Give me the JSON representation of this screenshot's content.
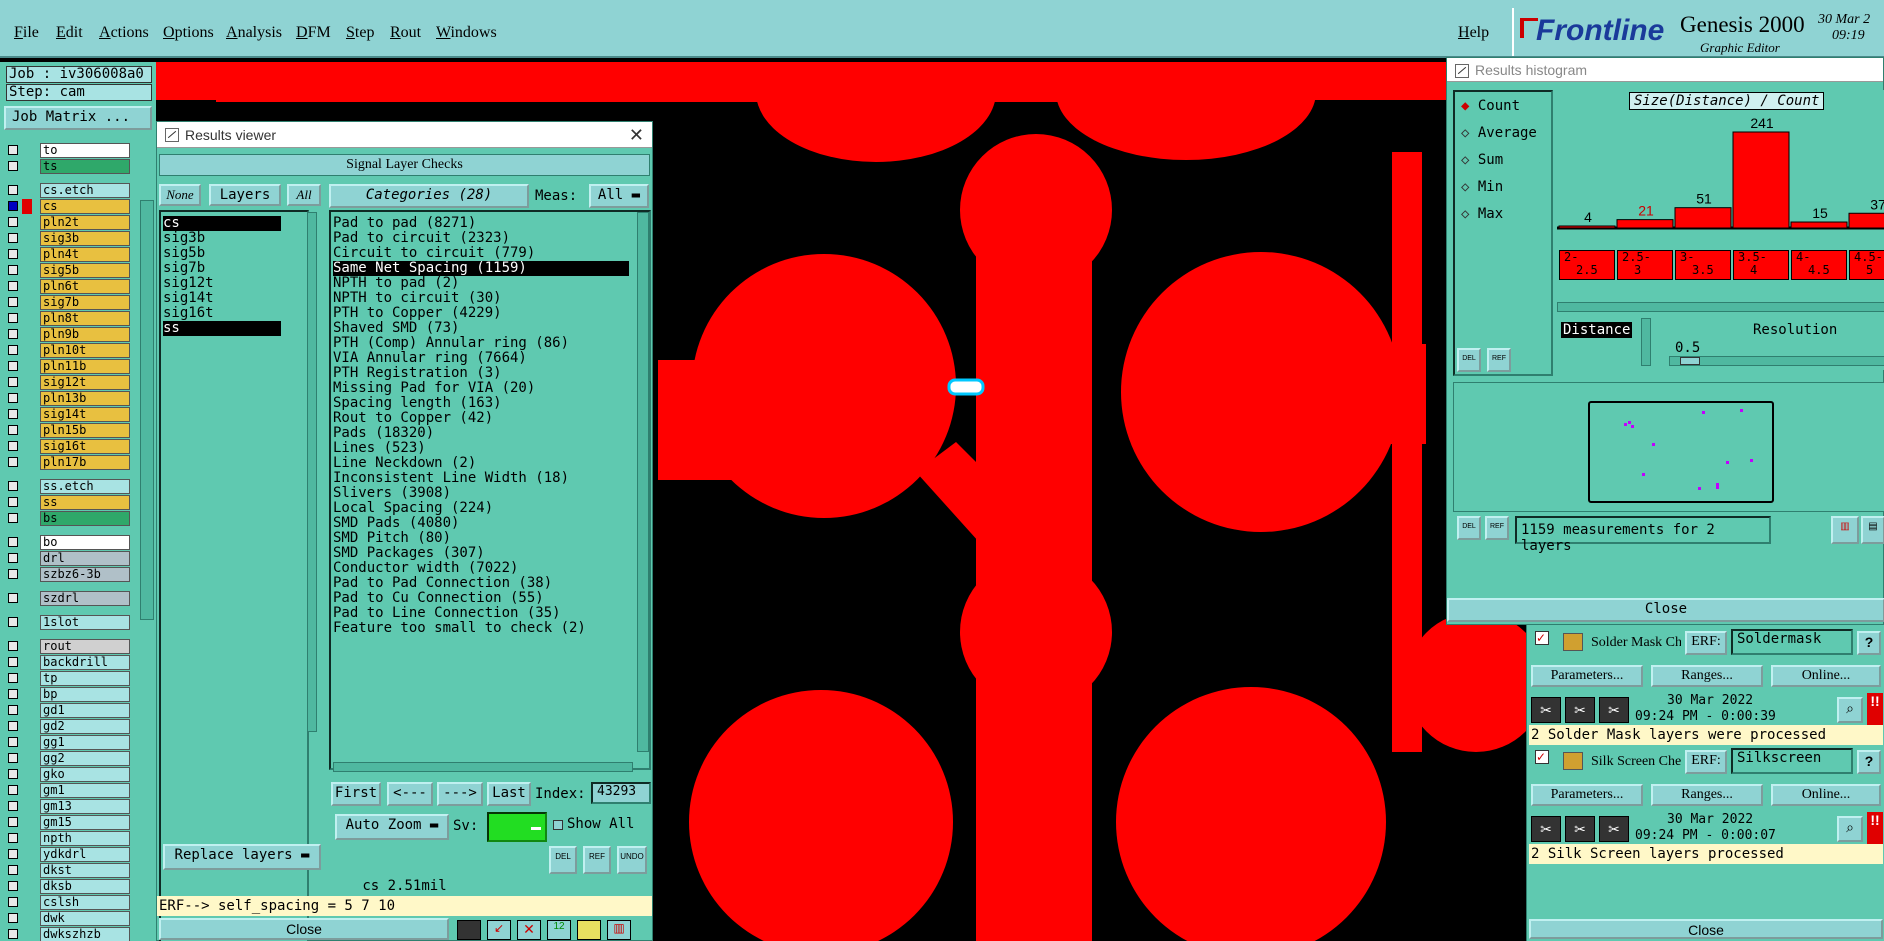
{
  "menubar": {
    "items": [
      "File",
      "Edit",
      "Actions",
      "Options",
      "Analysis",
      "DFM",
      "Step",
      "Rout",
      "Windows"
    ],
    "help": "Help",
    "logo_brand": "Frontline",
    "logo_product": "Genesis 2000",
    "logo_sub": "Graphic Editor",
    "date": "30 Mar 2",
    "time": "09:19"
  },
  "left": {
    "job": "Job : iv306008a0",
    "step": "Step: cam",
    "job_matrix": "Job Matrix ...",
    "layers": [
      {
        "name": "to",
        "color": "#ffffff",
        "sel": false
      },
      {
        "name": "ts",
        "color": "#2fa86a",
        "sel": false
      },
      {
        "name": "cs.etch",
        "color": "#a8e3e3",
        "sel": false
      },
      {
        "name": "cs",
        "color": "#e8c040",
        "sel": true
      },
      {
        "name": "pln2t",
        "color": "#e8c040",
        "sel": false
      },
      {
        "name": "sig3b",
        "color": "#e8c040",
        "sel": false
      },
      {
        "name": "pln4t",
        "color": "#e8c040",
        "sel": false
      },
      {
        "name": "sig5b",
        "color": "#e8c040",
        "sel": false
      },
      {
        "name": "pln6t",
        "color": "#e8c040",
        "sel": false
      },
      {
        "name": "sig7b",
        "color": "#e8c040",
        "sel": false
      },
      {
        "name": "pln8t",
        "color": "#e8c040",
        "sel": false
      },
      {
        "name": "pln9b",
        "color": "#e8c040",
        "sel": false
      },
      {
        "name": "pln10t",
        "color": "#e8c040",
        "sel": false
      },
      {
        "name": "pln11b",
        "color": "#e8c040",
        "sel": false
      },
      {
        "name": "sig12t",
        "color": "#e8c040",
        "sel": false
      },
      {
        "name": "pln13b",
        "color": "#e8c040",
        "sel": false
      },
      {
        "name": "sig14t",
        "color": "#e8c040",
        "sel": false
      },
      {
        "name": "pln15b",
        "color": "#e8c040",
        "sel": false
      },
      {
        "name": "sig16t",
        "color": "#e8c040",
        "sel": false
      },
      {
        "name": "pln17b",
        "color": "#e8c040",
        "sel": false
      },
      {
        "name": "ss.etch",
        "color": "#a8e3e3",
        "sel": false
      },
      {
        "name": "ss",
        "color": "#e8c040",
        "sel": false
      },
      {
        "name": "bs",
        "color": "#2fa86a",
        "sel": false
      },
      {
        "name": "bo",
        "color": "#ffffff",
        "sel": false
      },
      {
        "name": "drl",
        "color": "#b0c0c8",
        "sel": false
      },
      {
        "name": "szbz6-3b",
        "color": "#b0c0c8",
        "sel": false
      },
      {
        "name": "szdrl",
        "color": "#b0c0c8",
        "sel": false
      },
      {
        "name": "1slot",
        "color": "#a8e3e3",
        "sel": false
      },
      {
        "name": "rout",
        "color": "#d0d0d0",
        "sel": false
      },
      {
        "name": "backdrill",
        "color": "#a8e3e3",
        "sel": false
      },
      {
        "name": "tp",
        "color": "#a8e3e3",
        "sel": false
      },
      {
        "name": "bp",
        "color": "#a8e3e3",
        "sel": false
      },
      {
        "name": "gd1",
        "color": "#a8e3e3",
        "sel": false
      },
      {
        "name": "gd2",
        "color": "#a8e3e3",
        "sel": false
      },
      {
        "name": "gg1",
        "color": "#a8e3e3",
        "sel": false
      },
      {
        "name": "gg2",
        "color": "#a8e3e3",
        "sel": false
      },
      {
        "name": "gko",
        "color": "#a8e3e3",
        "sel": false
      },
      {
        "name": "gm1",
        "color": "#a8e3e3",
        "sel": false
      },
      {
        "name": "gm13",
        "color": "#a8e3e3",
        "sel": false
      },
      {
        "name": "gm15",
        "color": "#a8e3e3",
        "sel": false
      },
      {
        "name": "npth",
        "color": "#a8e3e3",
        "sel": false
      },
      {
        "name": "ydkdrl",
        "color": "#a8e3e3",
        "sel": false
      },
      {
        "name": "dkst",
        "color": "#a8e3e3",
        "sel": false
      },
      {
        "name": "dksb",
        "color": "#a8e3e3",
        "sel": false
      },
      {
        "name": "cslsh",
        "color": "#a8e3e3",
        "sel": false
      },
      {
        "name": "dwk",
        "color": "#a8e3e3",
        "sel": false
      },
      {
        "name": "dwkszhzb",
        "color": "#a8e3e3",
        "sel": false
      }
    ]
  },
  "results_viewer": {
    "title": "Results viewer",
    "header": "Signal Layer Checks",
    "none_btn": "None",
    "layers_btn": "Layers",
    "all_btn": "All",
    "categories_btn": "Categories (28)",
    "meas_label": "Meas:",
    "meas_value": "All",
    "layer_list": [
      "cs",
      "sig3b",
      "sig5b",
      "sig7b",
      "sig12t",
      "sig14t",
      "sig16t",
      "ss"
    ],
    "categories": [
      "Pad to pad (8271)",
      "Pad to circuit (2323)",
      "Circuit to circuit (779)",
      "Same Net Spacing (1159)",
      "NPTH to pad (2)",
      "NPTH to circuit (30)",
      "PTH to Copper (4229)",
      "Shaved SMD (73)",
      "PTH (Comp) Annular ring (86)",
      "VIA Annular ring (7664)",
      "PTH Registration (3)",
      "Missing Pad for VIA (20)",
      "Spacing length (163)",
      "Rout to Copper (42)",
      "Pads (18320)",
      "Lines (523)",
      "Line Neckdown (2)",
      "Inconsistent Line Width (18)",
      "Slivers (3908)",
      "Local Spacing (224)",
      "SMD Pads (4080)",
      "SMD Pitch (80)",
      "SMD Packages (307)",
      "Conductor width (7022)",
      "Pad to Pad Connection (38)",
      "Pad to Cu Connection (55)",
      "Pad to Line Connection (35)",
      "Feature too small to check (2)"
    ],
    "first_btn": "First",
    "prev_btn": "<---",
    "next_btn": "--->",
    "last_btn": "Last",
    "index_label": "Index:",
    "index_value": "43293",
    "auto_zoom": "Auto Zoom",
    "sv_label": "Sv:",
    "show_all": "Show All",
    "replace_layers": "Replace layers",
    "status": "cs 2.51mil",
    "erf": "ERF--> self_spacing = 5 7 10",
    "close": "Close"
  },
  "histogram": {
    "title": "Results histogram",
    "options": [
      "Count",
      "Average",
      "Sum",
      "Min",
      "Max"
    ],
    "chart_title": "Size(Distance) / Count",
    "distance_label": "Distance",
    "resolution_label": "Resolution",
    "resolution_value": "0.5",
    "summary": "1159 measurements for 2 layers",
    "close": "Close",
    "del": "DEL",
    "ref": "REF"
  },
  "chart_data": {
    "type": "bar",
    "title": "Size(Distance) / Count",
    "categories": [
      "2-2.5",
      "2.5-3",
      "3-3.5",
      "3.5-4",
      "4-4.5",
      "4.5-5"
    ],
    "category_labels_top": [
      "2-",
      "2.5-",
      "3-",
      "3.5-",
      "4-",
      "4.5-"
    ],
    "category_labels_bottom": [
      "2.5",
      "3",
      "3.5",
      "4",
      "4.5",
      "5"
    ],
    "values": [
      4,
      21,
      51,
      241,
      15,
      37
    ],
    "ylim": [
      0,
      241
    ],
    "highlight_color": "#ff0000"
  },
  "erf_panels": [
    {
      "name": "Solder Mask Che",
      "erf_label": "ERF:",
      "erf_value": "Soldermask",
      "params": "Parameters...",
      "ranges": "Ranges...",
      "online": "Online...",
      "date": "30 Mar 2022",
      "time": "09:24 PM - 0:00:39",
      "message": "2 Solder Mask layers were processed"
    },
    {
      "name": "Silk Screen Che",
      "erf_label": "ERF:",
      "erf_value": "Silkscreen",
      "params": "Parameters...",
      "ranges": "Ranges...",
      "online": "Online...",
      "date": "30 Mar 2022",
      "time": "09:24 PM - 0:00:07",
      "message": "2 Silk Screen layers processed"
    }
  ],
  "erf_close": "Close"
}
